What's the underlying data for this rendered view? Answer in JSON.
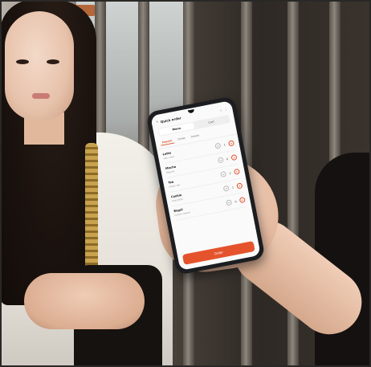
{
  "phone_app": {
    "title": "Quick order",
    "icons": {
      "back": "back-arrow-icon",
      "search": "search-icon",
      "menu": "more-icon"
    },
    "tabs": [
      {
        "label": "Menu",
        "active": true
      },
      {
        "label": "Cart",
        "active": false
      }
    ],
    "categories": [
      {
        "label": "Popular",
        "active": true
      },
      {
        "label": "Drinks",
        "active": false
      },
      {
        "label": "Snacks",
        "active": false
      }
    ],
    "items": [
      {
        "name": "Latte",
        "sub": "Hot / Iced",
        "qty": "1"
      },
      {
        "name": "Mocha",
        "sub": "Regular",
        "qty": "0"
      },
      {
        "name": "Tea",
        "sub": "Green tea",
        "qty": "2"
      },
      {
        "name": "Cookie",
        "sub": "Chocolate",
        "qty": "1"
      },
      {
        "name": "Bagel",
        "sub": "Cream cheese",
        "qty": "0"
      }
    ],
    "stepper_minus": "−",
    "stepper_plus": "+",
    "submit_label": "Order",
    "accent_color": "#e5532d"
  }
}
